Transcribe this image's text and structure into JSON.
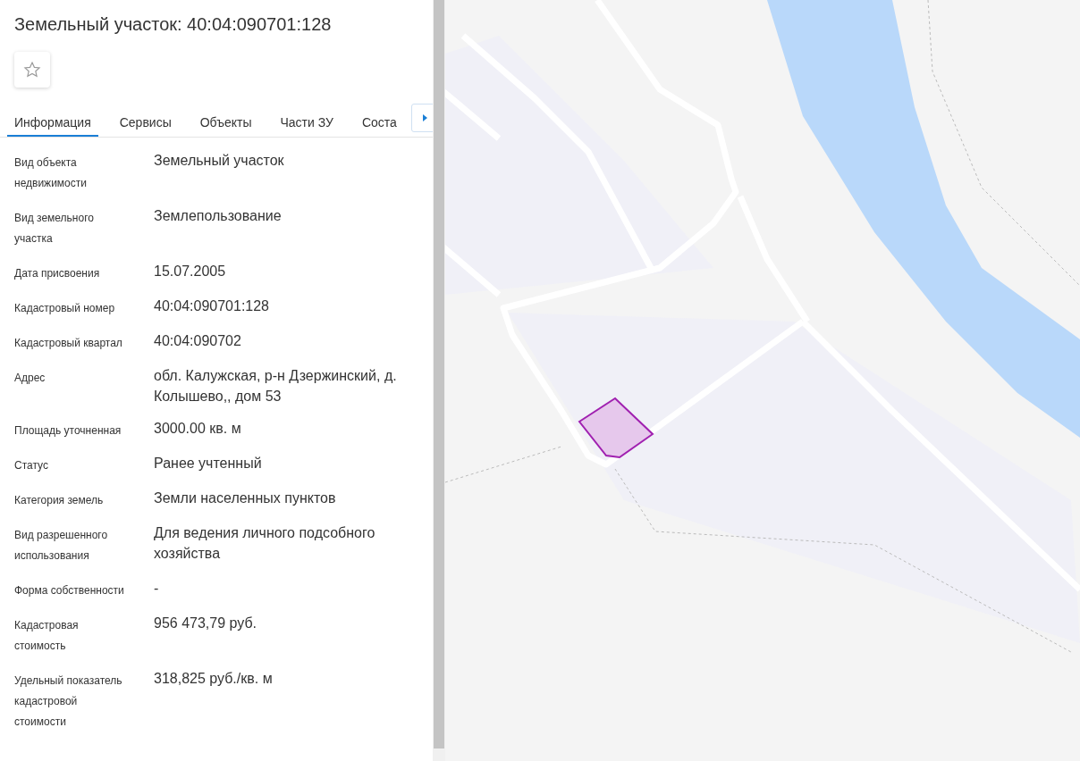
{
  "title": "Земельный участок: 40:04:090701:128",
  "tabs": [
    {
      "label": "Информация",
      "selected": true
    },
    {
      "label": "Сервисы",
      "selected": false
    },
    {
      "label": "Объекты",
      "selected": false
    },
    {
      "label": "Части ЗУ",
      "selected": false
    },
    {
      "label": "Соста",
      "selected": false
    }
  ],
  "properties": [
    {
      "label": "Вид объекта недвижимости",
      "value": "Земельный участок"
    },
    {
      "label": "Вид земельного участка",
      "value": "Землепользование"
    },
    {
      "label": "Дата присвоения",
      "value": "15.07.2005"
    },
    {
      "label": "Кадастровый номер",
      "value": "40:04:090701:128"
    },
    {
      "label": "Кадастровый квартал",
      "value": "40:04:090702"
    },
    {
      "label": "Адрес",
      "value": "обл. Калужская, р-н Дзержинский, д. Колышево,, дом 53"
    },
    {
      "label": "Площадь уточненная",
      "value": "3000.00 кв. м"
    },
    {
      "label": "Статус",
      "value": "Ранее учтенный"
    },
    {
      "label": "Категория земель",
      "value": "Земли населенных пунктов"
    },
    {
      "label": "Вид разрешенного использования",
      "value": "Для ведения личного подсобного хозяйства"
    },
    {
      "label": "Форма собственности",
      "value": "-"
    },
    {
      "label": "Кадастровая стоимость",
      "value": "956 473,79 руб."
    },
    {
      "label": "Удельный показатель кадастровой стоимости",
      "value": "318,825 руб./кв. м"
    }
  ]
}
